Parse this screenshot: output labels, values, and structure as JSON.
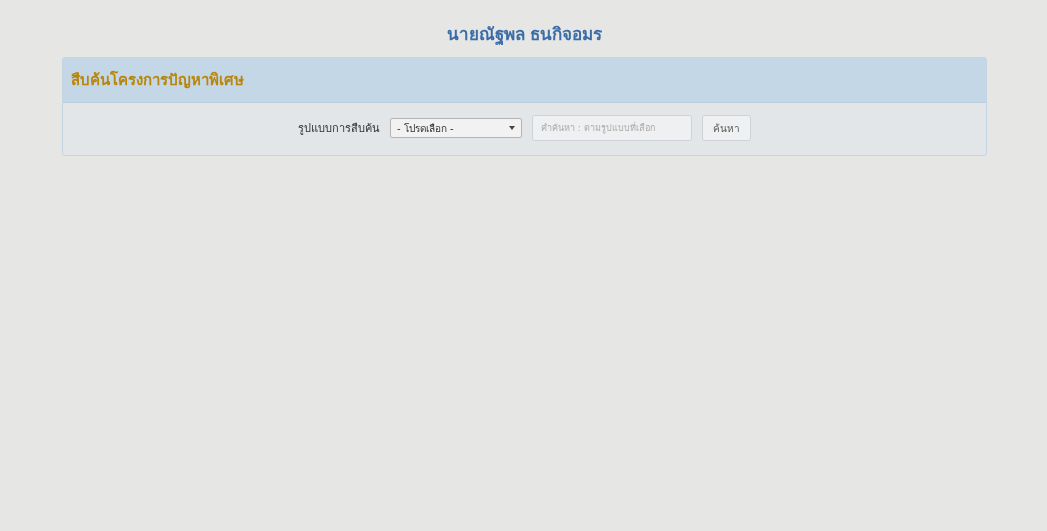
{
  "header": {
    "name": "นายณัฐพล ธนกิจอมร"
  },
  "panel": {
    "title": "สืบค้นโครงการปัญหาพิเศษ",
    "search": {
      "label": "รูปแบบการสืบค้น",
      "select_value": "- โปรดเลือก -",
      "placeholder": "คำค้นหา : ตามรูปแบบที่เลือก",
      "button": "ค้นหา"
    }
  }
}
